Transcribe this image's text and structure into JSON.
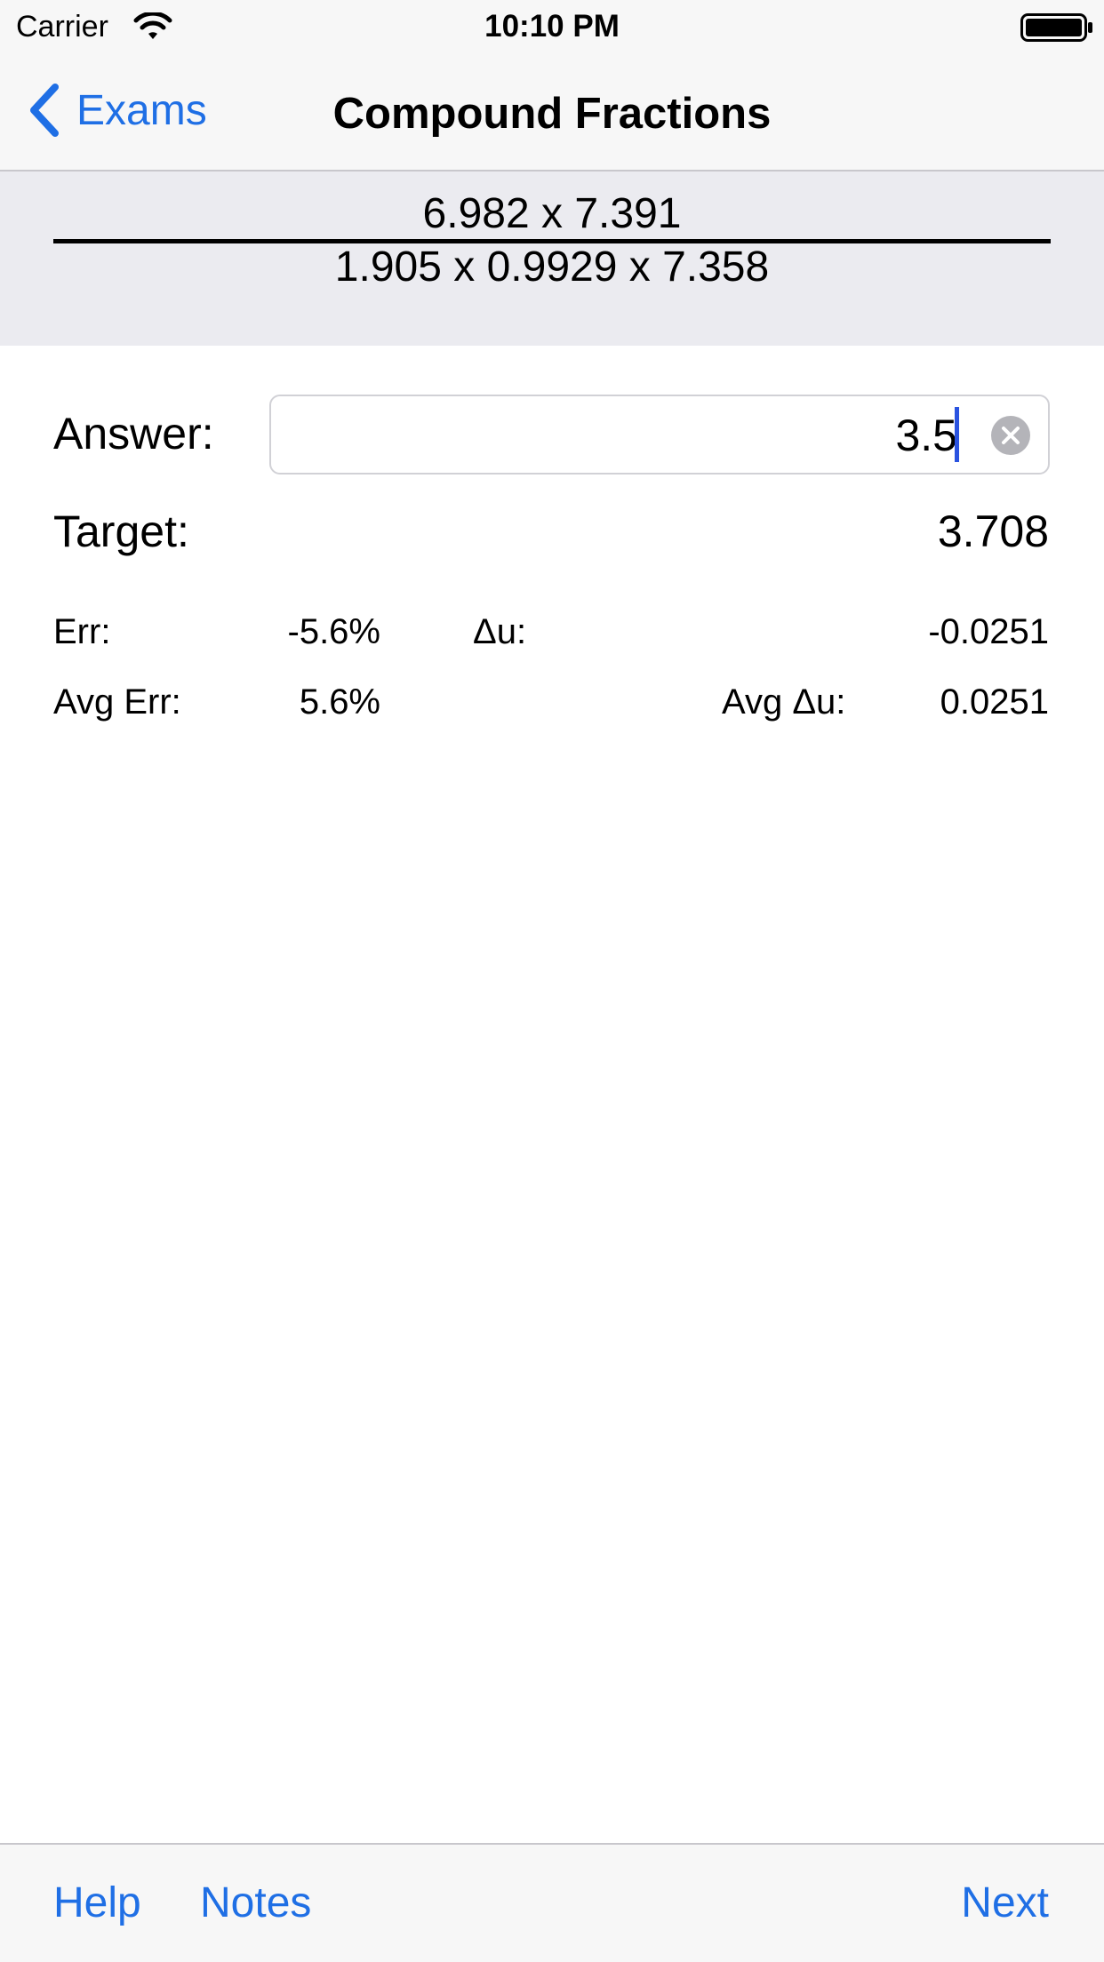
{
  "status_bar": {
    "carrier": "Carrier",
    "time": "10:10 PM",
    "wifi_icon": "wifi-icon",
    "battery_icon": "battery-full-icon"
  },
  "nav": {
    "back_label": "Exams",
    "back_icon": "chevron-left-icon",
    "title": "Compound Fractions"
  },
  "problem": {
    "numerator": "6.982 x 7.391",
    "denominator": "1.905 x 0.9929 x 7.358"
  },
  "answer": {
    "label": "Answer:",
    "value": "3.5",
    "clear_icon": "clear-circle-icon"
  },
  "target": {
    "label": "Target:",
    "value": "3.708"
  },
  "stats": {
    "err_label": "Err:",
    "err_value": "-5.6%",
    "du_label": "Δu:",
    "du_value": "-0.0251",
    "avg_err_label": "Avg Err:",
    "avg_err_value": "5.6%",
    "avg_du_label": "Avg Δu:",
    "avg_du_value": "0.0251"
  },
  "toolbar": {
    "help_label": "Help",
    "notes_label": "Notes",
    "next_label": "Next"
  },
  "colors": {
    "accent": "#1f6fe5",
    "caret": "#2a53e0",
    "problem_bg": "#ebebf0",
    "bar_bg": "#f7f7f7"
  }
}
